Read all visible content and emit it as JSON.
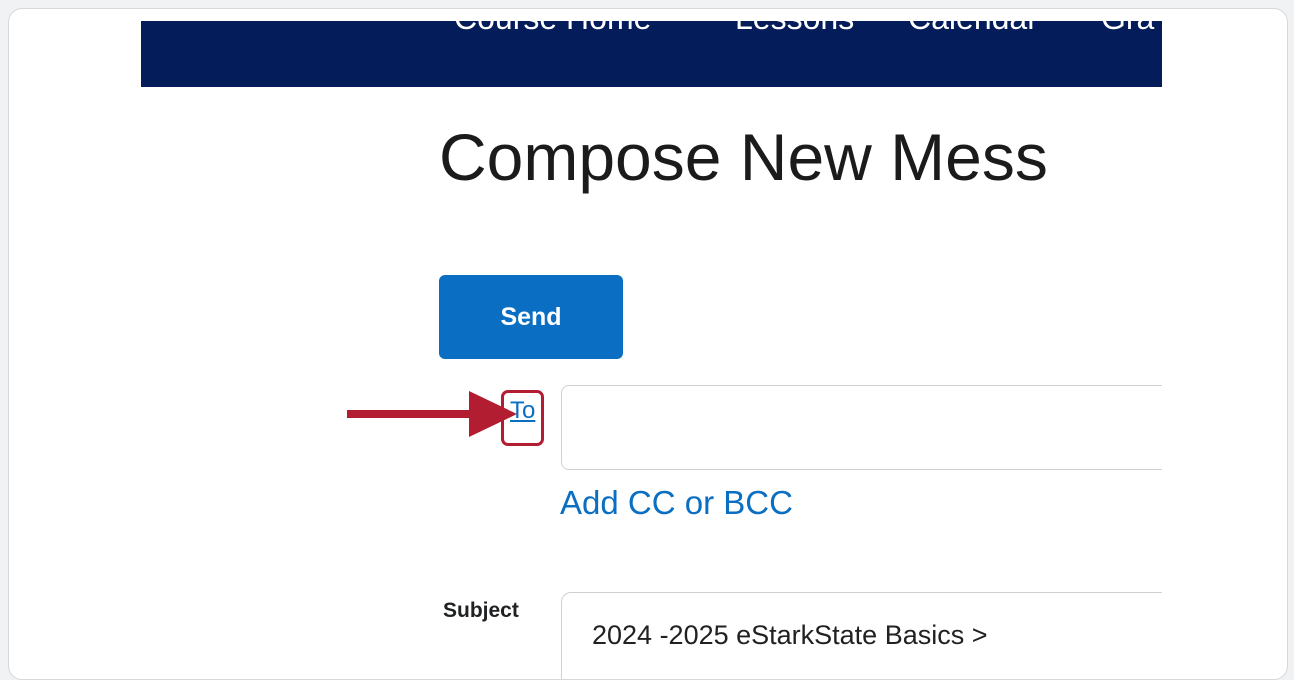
{
  "nav": {
    "items": [
      "Course Home",
      "Lessons",
      "Calendar",
      "Gra"
    ]
  },
  "page": {
    "title": "Compose New Mess"
  },
  "compose": {
    "send_label": "Send",
    "to_label": "To",
    "to_value": "",
    "add_cc_label": "Add CC or BCC",
    "subject_label": "Subject",
    "subject_value": "2024 -2025 eStarkState Basics >"
  },
  "colors": {
    "nav_background": "#041c5a",
    "accent": "#0a6fc2",
    "highlight": "#b21d32"
  },
  "icons": {
    "annotation": "arrow-right-icon"
  }
}
